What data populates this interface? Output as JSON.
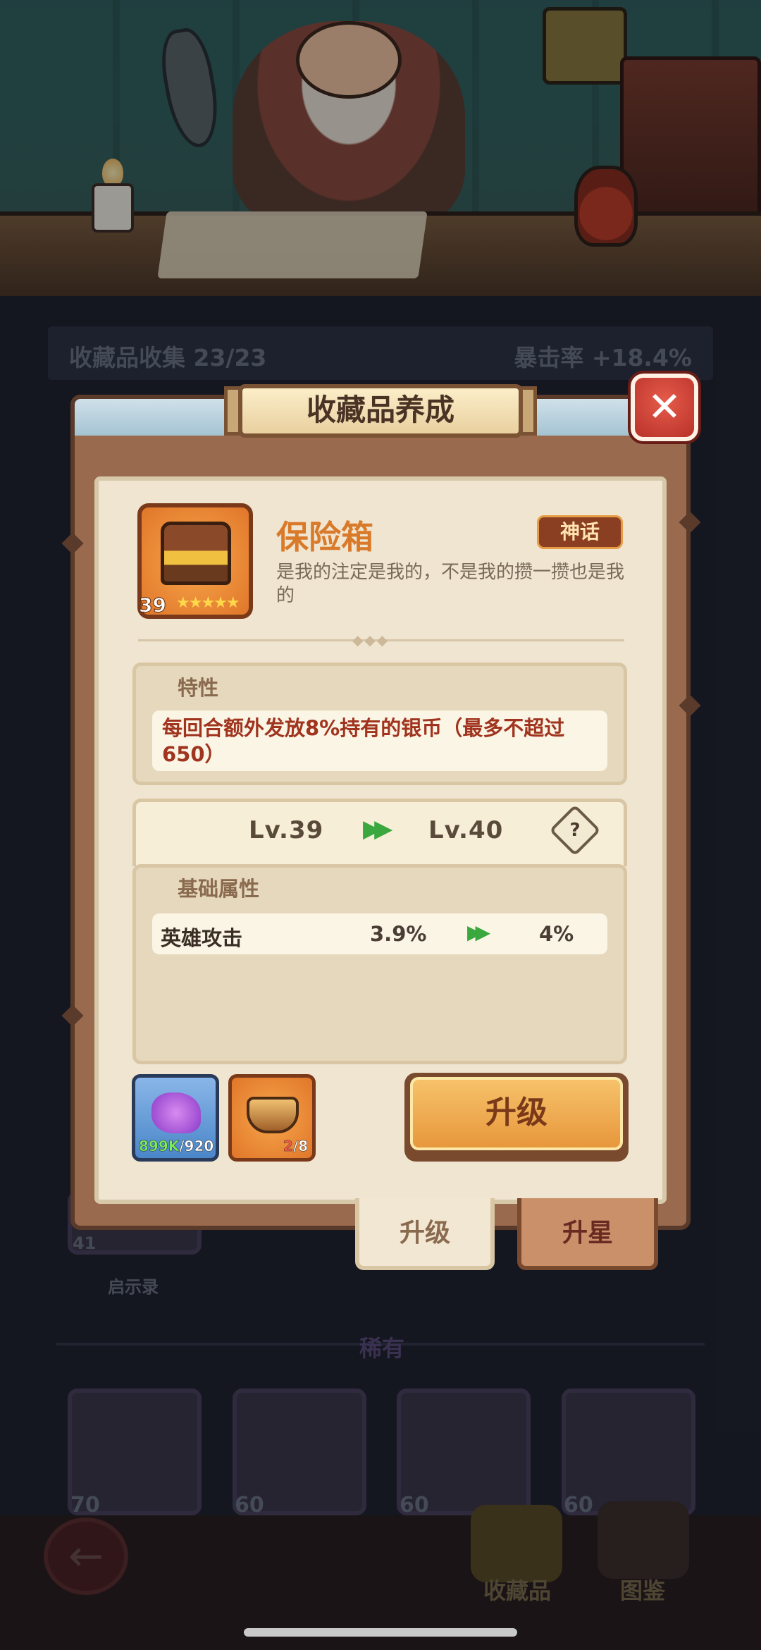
{
  "background": {
    "collection_label": "收藏品收集",
    "collection_count": "23/23",
    "crit_label": "暴击率",
    "crit_value": "+18.4%",
    "card_label": "启示录",
    "card_level": "41",
    "rarity_section": "稀有",
    "rare_levels": [
      "70",
      "60",
      "60",
      "60"
    ],
    "nav": {
      "collection_label": "收藏品",
      "catalog_label": "图鉴"
    }
  },
  "modal": {
    "title": "收藏品养成",
    "close_symbol": "✕",
    "item": {
      "name": "保险箱",
      "rarity": "神话",
      "description": "是我的注定是我的，不是我的攒一攒也是我的",
      "level": "39",
      "stars": "★★★★★"
    },
    "trait": {
      "title": "特性",
      "text": "每回合额外发放8%持有的银币（最多不超过650）"
    },
    "level_change": {
      "current": "Lv.39",
      "next": "Lv.40",
      "help_symbol": "?"
    },
    "base_stats": {
      "title": "基础属性",
      "rows": [
        {
          "label": "英雄攻击",
          "current": "3.9%",
          "next": "4%"
        }
      ]
    },
    "materials": [
      {
        "icon": "purple-crystal-icon",
        "owned": "899K",
        "required": "/920"
      },
      {
        "icon": "wooden-bowl-icon",
        "owned": "2",
        "required": "/8"
      }
    ],
    "upgrade_button": "升级",
    "tabs": {
      "upgrade": "升级",
      "star_up": "升星"
    }
  },
  "colors": {
    "accent_orange": "#d97a2a",
    "trait_red": "#a0341e",
    "arrow_green": "#3aa83e",
    "close_red": "#b8322a"
  }
}
